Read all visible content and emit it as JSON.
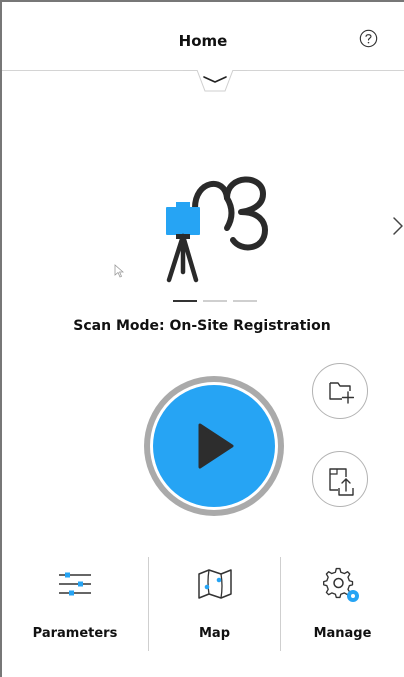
{
  "header": {
    "title": "Home",
    "help_icon": "question-circle-icon",
    "collapse_icon": "chevron-down-icon"
  },
  "scan": {
    "mode_label": "Scan Mode: On-Site Registration",
    "illustration_icon": "scanner-on-tripod-icon",
    "next_icon": "chevron-right-icon",
    "carousel_pages": 3,
    "carousel_active": 1
  },
  "actions": {
    "play_icon": "play-icon",
    "new_project_icon": "folder-add-icon",
    "export_icon": "file-export-icon"
  },
  "nav": {
    "items": [
      {
        "label": "Parameters",
        "icon": "sliders-icon"
      },
      {
        "label": "Map",
        "icon": "map-icon"
      },
      {
        "label": "Manage",
        "icon": "settings-gear-icon"
      }
    ]
  },
  "colors": {
    "accent": "#26a4f4",
    "text": "#111111",
    "border": "#d4d4d4"
  }
}
